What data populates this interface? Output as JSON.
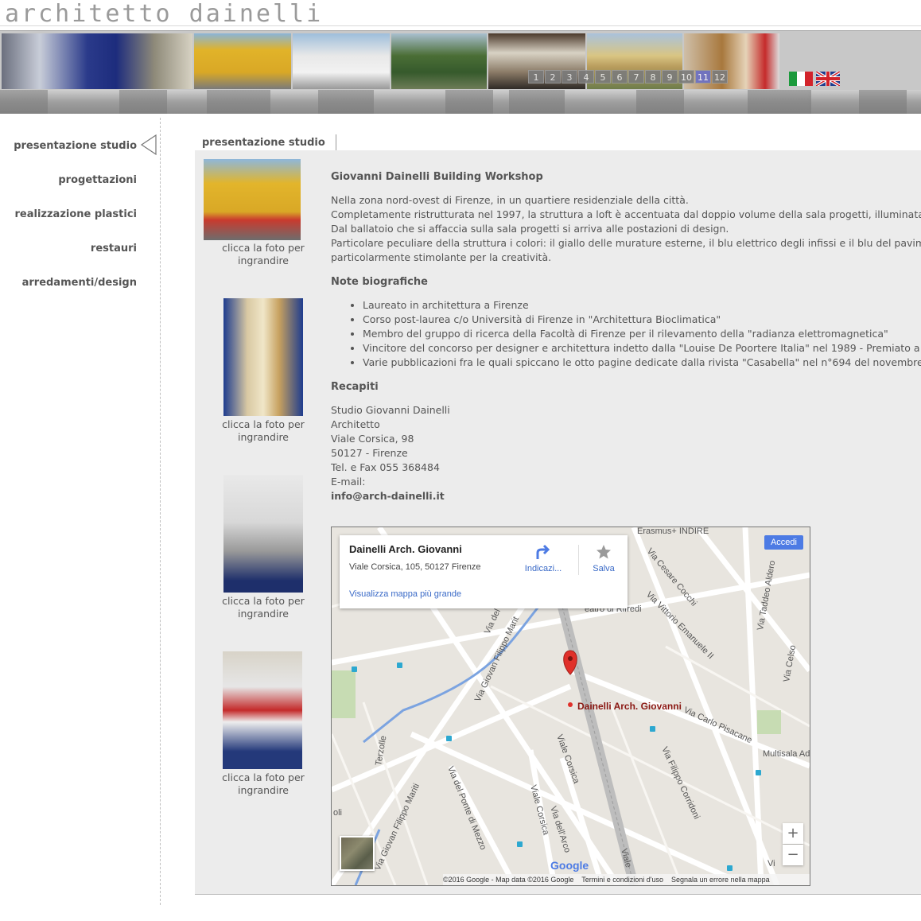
{
  "site": {
    "logo": "architetto dainelli"
  },
  "header": {
    "pages": [
      "1",
      "2",
      "3",
      "4",
      "5",
      "6",
      "7",
      "8",
      "9",
      "10",
      "11",
      "12"
    ],
    "active_page": "11",
    "languages": [
      "italiano-flag",
      "english-flag"
    ]
  },
  "sidebar": {
    "items": [
      {
        "label": "presentazione studio"
      },
      {
        "label": "progettazioni"
      },
      {
        "label": "realizzazione plastici"
      },
      {
        "label": "restauri"
      },
      {
        "label": "arredamenti/design"
      }
    ]
  },
  "main": {
    "tab": "presentazione studio",
    "thumb_caption": "clicca la foto per",
    "thumb_caption2": "ingrandire",
    "title": "Giovanni Dainelli Building Workshop",
    "intro": [
      "Nella zona nord-ovest di Firenze, in un quartiere residenziale della città.",
      "Completamente ristrutturata nel 1997, la struttura a loft è accentuata dal doppio volume della sala progetti, illuminata",
      "Dal ballatoio che si affaccia sulla sala progetti si arriva alle postazioni di design.",
      "Particolare peculiare della struttura i colori: il giallo delle murature esterne, il blu elettrico degli infissi e il blu del pavim",
      "particolarmente stimolante per la creatività."
    ],
    "bio_title": "Note biografiche",
    "bio": [
      "Laureato in architettura a Firenze",
      "Corso post-laurea c/o Università di Firenze in \"Architettura Bioclimatica\"",
      "Membro del gruppo di ricerca della Facoltà di Firenze per il rilevamento della \"radianza elettromagnetica\"",
      "Vincitore del concorso per designer e architettura indetto dalla \"Louise De Poortere Italia\" nel 1989 - Premiato a",
      "Varie pubblicazioni fra le quali spiccano le otto pagine dedicate dalla rivista \"Casabella\" nel n°694 del novembre"
    ],
    "contacts_title": "Recapiti",
    "contacts": [
      "Studio Giovanni Dainelli",
      "Architetto",
      "Viale Corsica, 98",
      "50127 - Firenze",
      "Tel. e Fax  055 368484",
      "E-mail:"
    ],
    "email": "info@arch-dainelli.it"
  },
  "map": {
    "place_name": "Dainelli Arch. Giovanni",
    "address": "Viale Corsica, 105, 50127 Firenze",
    "directions": "Indicazi...",
    "save": "Salva",
    "larger_map": "Visualizza mappa più grande",
    "sign_in": "Accedi",
    "marker_label": "Dainelli Arch. Giovanni",
    "zoom_in": "+",
    "zoom_out": "−",
    "google": "Google",
    "copyright": "©2016 Google - Map data ©2016 Google",
    "terms": "Termini e condizioni d'uso",
    "report": "Segnala un errore nella mappa",
    "streets": {
      "erasmus": "Erasmus+ INDIRE",
      "cocchi": "Via Cesare Cocchi",
      "aldero": "Via Taddeo Aldero",
      "emanuele": "Via Vittorio Emanuele II",
      "celso": "Via Celso",
      "ferredi": "eatro di Rifredi",
      "marit": "Via Giovan Filippo Marit",
      "via_del": "Via del",
      "pisacane": "Via Carlo Pisacane",
      "multisala": "Multisala Ad",
      "terzolle": "Terzolle",
      "corsica": "Viale Corsica",
      "corsica2": "Viale Corsica",
      "corridoni": "Via Filippo Corridoni",
      "mariti2": "Via Giovan Filippo Mariti",
      "ponte": "Via del Ponte di Mezzo",
      "arco": "Via dell'Arco",
      "viale": "Viale",
      "oli": "oli",
      "vi": "Vi"
    }
  },
  "colors": {
    "accent_page": "#6a6fc7",
    "text": "#555555",
    "map_bg": "#e8e5df"
  }
}
